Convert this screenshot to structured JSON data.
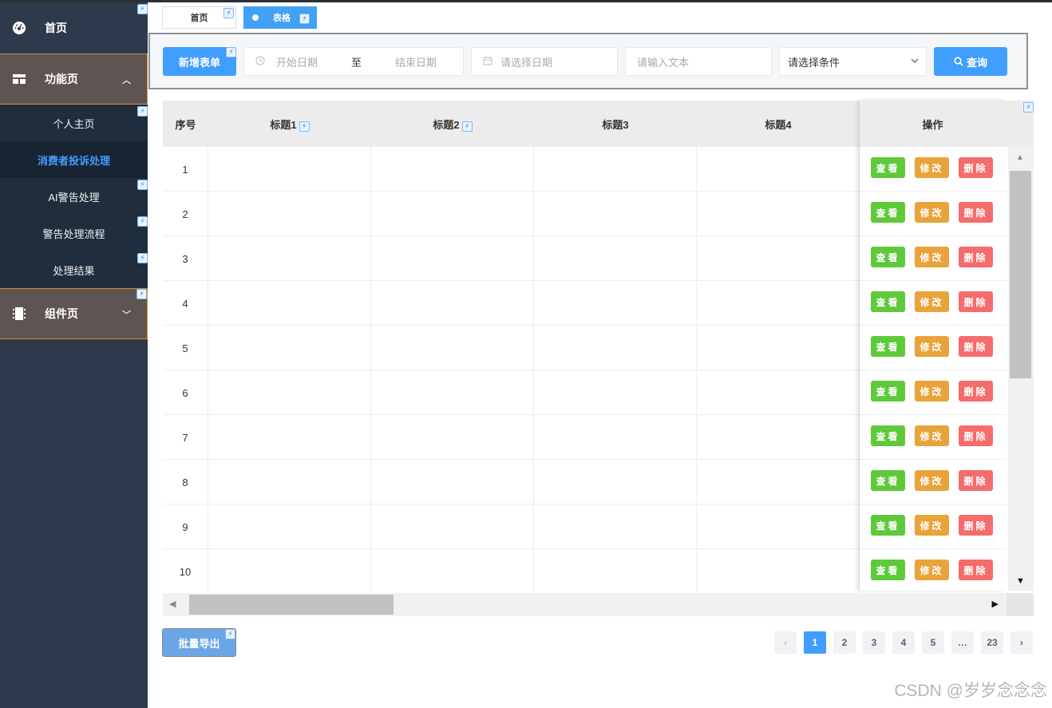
{
  "sidebar": {
    "home": "首页",
    "group_function": "功能页",
    "sub_items": [
      "个人主页",
      "消费者投诉处理",
      "AI警告处理",
      "警告处理流程",
      "处理结果"
    ],
    "group_components": "组件页"
  },
  "tabs": [
    "首页",
    "表格"
  ],
  "toolbar": {
    "add_label": "新增表单",
    "start_date_placeholder": "开始日期",
    "range_separator": "至",
    "end_date_placeholder": "结束日期",
    "date_placeholder": "请选择日期",
    "text_placeholder": "请输入文本",
    "select_value": "请选择条件",
    "search_label": "查询"
  },
  "table": {
    "columns": [
      "序号",
      "标题1",
      "标题2",
      "标题3",
      "标题4",
      "操作"
    ],
    "rows": [
      "1",
      "2",
      "3",
      "4",
      "5",
      "6",
      "7",
      "8",
      "9",
      "10"
    ],
    "actions": {
      "view": "查看",
      "edit": "修改",
      "delete": "删除"
    }
  },
  "export_label": "批量导出",
  "pagination": {
    "pages": [
      "1",
      "2",
      "3",
      "4",
      "5",
      "…",
      "23"
    ],
    "current": "1",
    "prev": "‹",
    "next": "›"
  },
  "watermark": "CSDN @岁岁念念念",
  "colors": {
    "sidebar_bg": "#2d3a4b",
    "primary": "#409eff",
    "view": "#5fc93a",
    "edit": "#e8a33a",
    "delete": "#f56c6c",
    "group_highlight": "#d98c2d"
  }
}
